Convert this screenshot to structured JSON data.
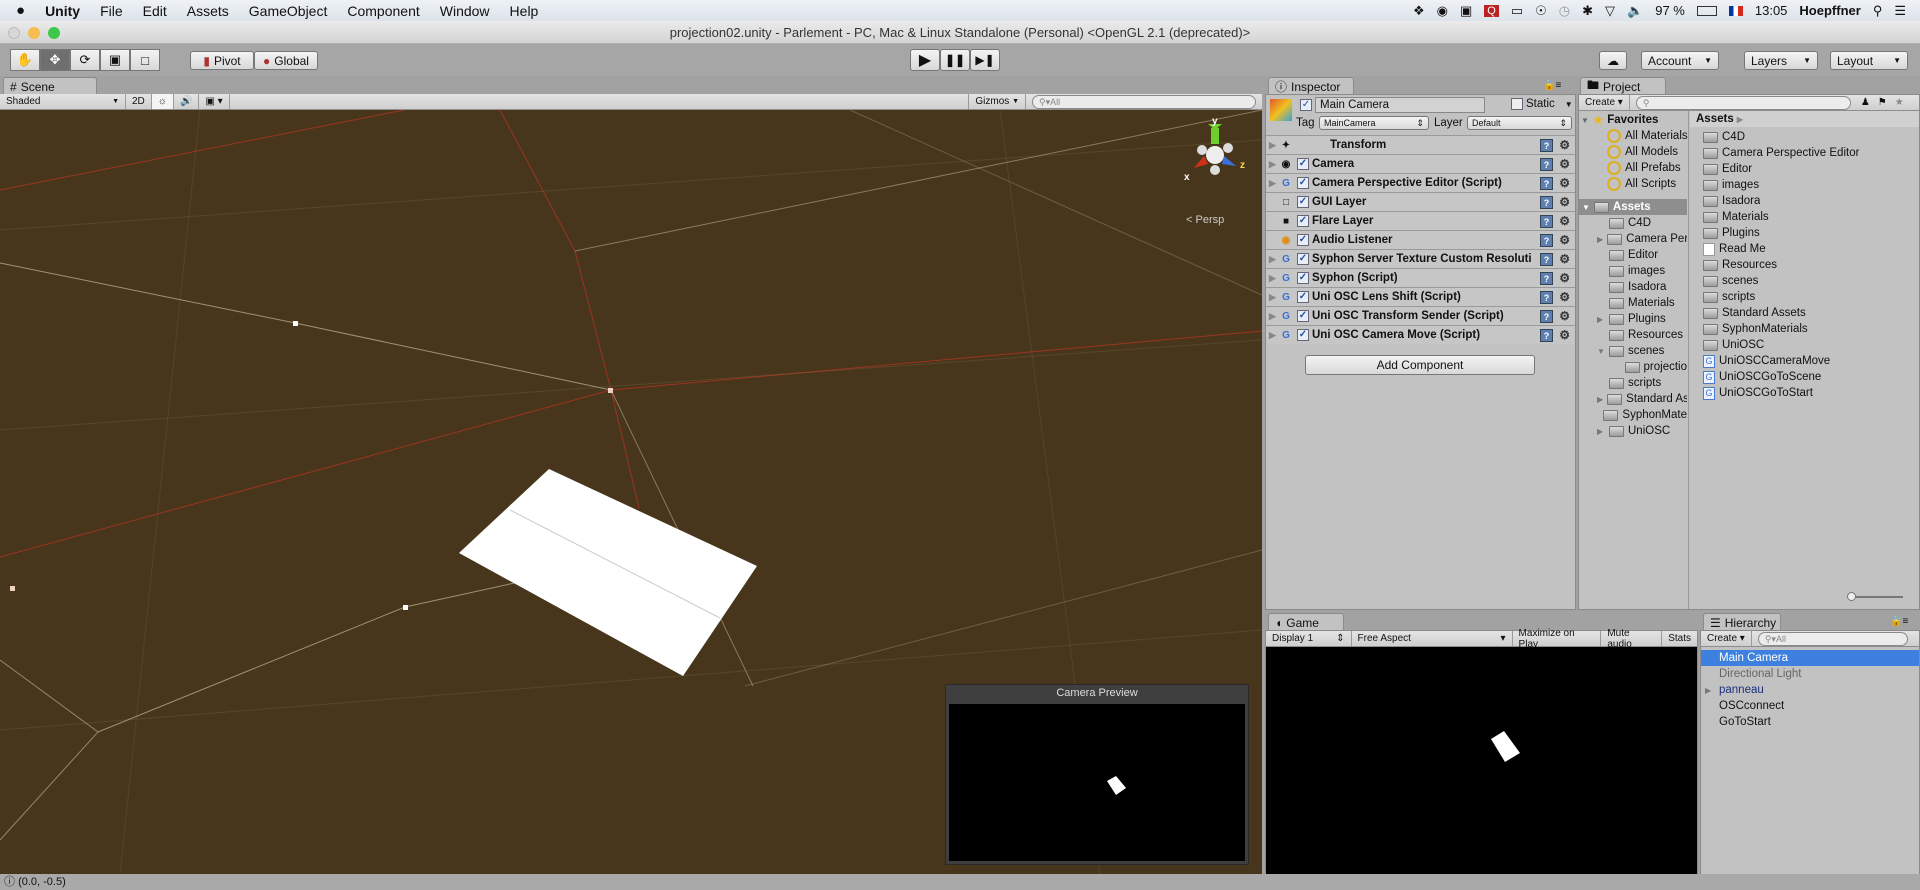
{
  "menubar": {
    "apple": "",
    "items": [
      "Unity",
      "File",
      "Edit",
      "Assets",
      "GameObject",
      "Component",
      "Window",
      "Help"
    ],
    "battery": "97 %",
    "clock": "13:05",
    "user": "Hoepffner"
  },
  "window": {
    "title": "projection02.unity - Parlement - PC, Mac & Linux Standalone (Personal) <OpenGL 2.1 (deprecated)>"
  },
  "toolbar": {
    "tools": [
      "hand-icon",
      "move-icon",
      "rotate-icon",
      "scale-icon",
      "rect-icon"
    ],
    "active_tool": "move-icon",
    "pivot": "Pivot",
    "global": "Global",
    "account": "Account",
    "layers": "Layers",
    "layout": "Layout"
  },
  "scene": {
    "tab": "Scene",
    "shading": "Shaded",
    "mode_2d": "2D",
    "gizmos": "Gizmos",
    "search_placeholder": "All",
    "gizmo_axes": {
      "x": "x",
      "y": "y",
      "z": "z"
    },
    "projection": "Persp",
    "camera_preview_title": "Camera Preview",
    "colors": {
      "background": "#47361b",
      "grid_red": "#9b3420",
      "grid_light": "#b8a98a"
    }
  },
  "status": {
    "message": "(0.0, -0.5)"
  },
  "inspector": {
    "tab": "Inspector",
    "object_name": "Main Camera",
    "static_label": "Static",
    "tag_label": "Tag",
    "tag_value": "MainCamera",
    "layer_label": "Layer",
    "layer_value": "Default",
    "components": [
      {
        "name": "Transform",
        "icon": "transform-icon",
        "checkbox": false,
        "foldout": true
      },
      {
        "name": "Camera",
        "icon": "camera-icon",
        "checkbox": true,
        "foldout": true
      },
      {
        "name": "Camera Perspective Editor (Script)",
        "icon": "script-icon",
        "checkbox": true,
        "foldout": true
      },
      {
        "name": "GUI Layer",
        "icon": "gui-layer-icon",
        "checkbox": true,
        "foldout": false
      },
      {
        "name": "Flare Layer",
        "icon": "flare-layer-icon",
        "checkbox": true,
        "foldout": false
      },
      {
        "name": "Audio Listener",
        "icon": "audio-listener-icon",
        "checkbox": true,
        "foldout": false
      },
      {
        "name": "Syphon Server Texture Custom Resoluti",
        "icon": "script-icon",
        "checkbox": true,
        "foldout": true
      },
      {
        "name": "Syphon (Script)",
        "icon": "script-icon",
        "checkbox": true,
        "foldout": true
      },
      {
        "name": "Uni OSC Lens Shift (Script)",
        "icon": "script-icon",
        "checkbox": true,
        "foldout": true
      },
      {
        "name": "Uni OSC Transform Sender (Script)",
        "icon": "script-icon",
        "checkbox": true,
        "foldout": true
      },
      {
        "name": "Uni OSC Camera Move (Script)",
        "icon": "script-icon",
        "checkbox": true,
        "foldout": true
      }
    ],
    "add_component": "Add Component"
  },
  "project": {
    "tab": "Project",
    "create": "Create",
    "favorites_label": "Favorites",
    "favorites": [
      "All Materials",
      "All Models",
      "All Prefabs",
      "All Scripts"
    ],
    "assets_label": "Assets",
    "tree": [
      {
        "name": "C4D",
        "depth": 1,
        "expandable": false
      },
      {
        "name": "Camera Pers",
        "depth": 1,
        "expandable": true
      },
      {
        "name": "Editor",
        "depth": 1,
        "expandable": false
      },
      {
        "name": "images",
        "depth": 1,
        "expandable": false
      },
      {
        "name": "Isadora",
        "depth": 1,
        "expandable": false
      },
      {
        "name": "Materials",
        "depth": 1,
        "expandable": false
      },
      {
        "name": "Plugins",
        "depth": 1,
        "expandable": true
      },
      {
        "name": "Resources",
        "depth": 1,
        "expandable": false
      },
      {
        "name": "scenes",
        "depth": 1,
        "expandable": true,
        "expanded": true
      },
      {
        "name": "projectio",
        "depth": 2,
        "expandable": false
      },
      {
        "name": "scripts",
        "depth": 1,
        "expandable": false
      },
      {
        "name": "Standard As",
        "depth": 1,
        "expandable": true
      },
      {
        "name": "SyphonMate",
        "depth": 1,
        "expandable": false
      },
      {
        "name": "UniOSC",
        "depth": 1,
        "expandable": true
      }
    ],
    "breadcrumb": "Assets",
    "items": [
      {
        "name": "C4D",
        "type": "folder"
      },
      {
        "name": "Camera Perspective Editor",
        "type": "folder"
      },
      {
        "name": "Editor",
        "type": "folder"
      },
      {
        "name": "images",
        "type": "folder"
      },
      {
        "name": "Isadora",
        "type": "folder"
      },
      {
        "name": "Materials",
        "type": "folder"
      },
      {
        "name": "Plugins",
        "type": "folder"
      },
      {
        "name": "Read Me",
        "type": "document"
      },
      {
        "name": "Resources",
        "type": "folder"
      },
      {
        "name": "scenes",
        "type": "folder"
      },
      {
        "name": "scripts",
        "type": "folder"
      },
      {
        "name": "Standard Assets",
        "type": "folder"
      },
      {
        "name": "SyphonMaterials",
        "type": "folder"
      },
      {
        "name": "UniOSC",
        "type": "folder"
      },
      {
        "name": "UniOSCCameraMove",
        "type": "script"
      },
      {
        "name": "UniOSCGoToScene",
        "type": "script"
      },
      {
        "name": "UniOSCGoToStart",
        "type": "script"
      }
    ]
  },
  "game": {
    "tab": "Game",
    "display": "Display 1",
    "aspect": "Free Aspect",
    "maximize": "Maximize on Play",
    "mute": "Mute audio",
    "stats": "Stats"
  },
  "hierarchy": {
    "tab": "Hierarchy",
    "create": "Create",
    "search_placeholder": "All",
    "items": [
      {
        "name": "Main Camera",
        "selected": true
      },
      {
        "name": "Directional Light",
        "disabled": true
      },
      {
        "name": "panneau",
        "prefab": true,
        "expandable": true
      },
      {
        "name": "OSCconnect"
      },
      {
        "name": "GoToStart"
      }
    ],
    "selection_color": "#3d80df"
  }
}
